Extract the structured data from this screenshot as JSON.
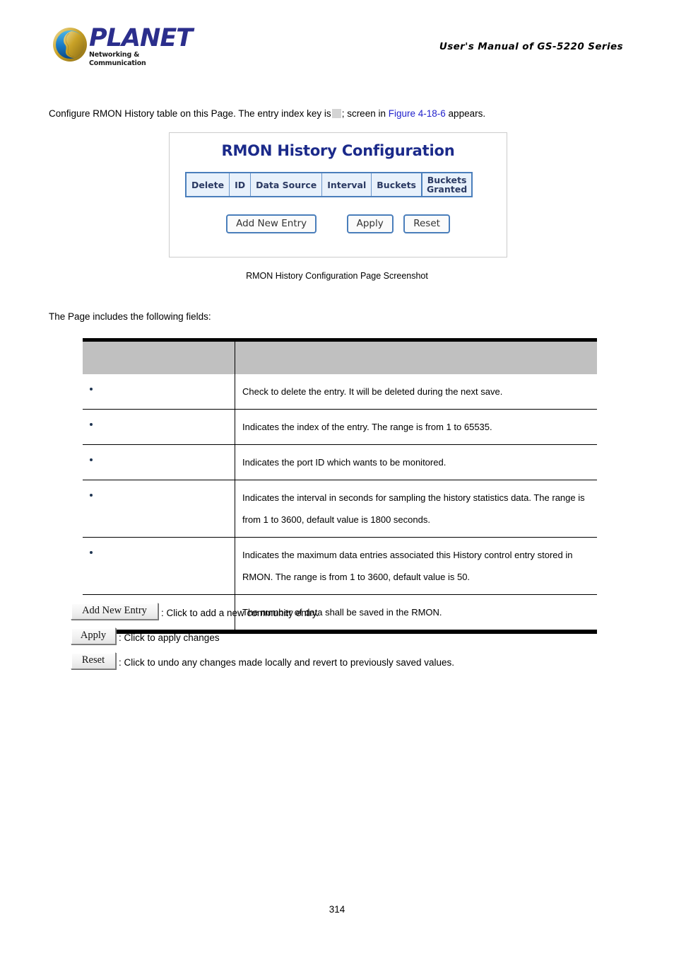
{
  "header": {
    "logo_brand": "PLANET",
    "logo_tagline": "Networking & Communication",
    "manual_title": "User's Manual of GS-5220 Series"
  },
  "intro": {
    "text_before": "Configure RMON History table on this Page. The entry index key is",
    "missing_field_placeholder": "",
    "text_middle": "; screen in",
    "figure_link": "Figure 4-18-6",
    "text_after": "appears."
  },
  "screenshot": {
    "title": "RMON History Configuration",
    "table_headers": [
      "Delete",
      "ID",
      "Data Source",
      "Interval",
      "Buckets",
      "Buckets Granted"
    ],
    "buttons": [
      "Add New Entry",
      "Apply",
      "Reset"
    ]
  },
  "caption": "RMON History Configuration Page Screenshot",
  "lead_in": "The Page includes the following fields:",
  "field_table": {
    "headers": {
      "object": "",
      "description": ""
    },
    "rows": [
      {
        "object": "",
        "description": "Check to delete the entry. It will be deleted during the next save."
      },
      {
        "object": "",
        "description": "Indicates the index of the entry. The range is from 1 to 65535."
      },
      {
        "object": "",
        "description": "Indicates the port ID which wants to be monitored."
      },
      {
        "object": "",
        "description": "Indicates the interval in seconds for sampling the history statistics data. The range is from 1 to 3600, default value is 1800 seconds."
      },
      {
        "object": "",
        "description": "Indicates the maximum data entries associated this History control entry stored in RMON. The range is from 1 to 3600, default value is 50."
      },
      {
        "object": "",
        "description": "The number of data shall be saved in the RMON."
      }
    ]
  },
  "legend": [
    {
      "button": "Add New Entry",
      "description": ": Click to add a new community entry."
    },
    {
      "button": "Apply",
      "description": ": Click to apply changes"
    },
    {
      "button": "Reset",
      "description": ": Click to undo any changes made locally and revert to previously saved values."
    }
  ],
  "footer": {
    "page_number": "314"
  },
  "colors": {
    "brand_blue": "#2b2e8c",
    "link_blue": "#2222cc",
    "screenshot_title_blue": "#1b2a8a",
    "table_header_gray": "#c0c0c0",
    "cell_blue": "#e8f1fb",
    "border_blue": "#4a7ebb",
    "bullet_navy": "#1f3552"
  }
}
